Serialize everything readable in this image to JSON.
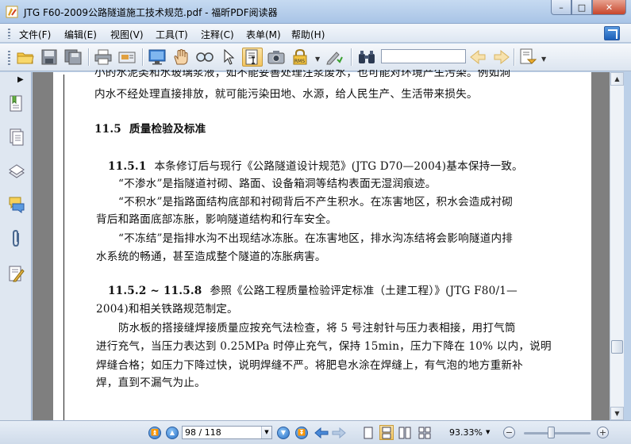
{
  "window": {
    "title": "JTG F60-2009公路隧道施工技术规范.pdf - 福昕PDF阅读器",
    "minimize": "–",
    "maximize": "□",
    "close": "✕"
  },
  "menu": [
    {
      "label": "文件(F)"
    },
    {
      "label": "编辑(E)"
    },
    {
      "label": "视图(V)"
    },
    {
      "label": "工具(T)"
    },
    {
      "label": "注释(C)"
    },
    {
      "label": "表单(M)"
    },
    {
      "label": "帮助(H)"
    }
  ],
  "toolbar": {
    "search_value": "",
    "icons": [
      "open-folder-icon",
      "save-icon",
      "save-as-icon",
      "print-icon",
      "scan-icon",
      "fullscreen-icon",
      "hand-icon",
      "zoom-glass-icon",
      "select-arrow-icon",
      "text-select-icon",
      "snapshot-icon",
      "rms-icon",
      "sign-icon",
      "binoculars-icon",
      "search-prev-icon",
      "search-next-icon",
      "highlight-icon"
    ]
  },
  "sidebar": {
    "icons": [
      "bookmarks-icon",
      "pages-icon",
      "layers-icon",
      "comments-icon",
      "attachments-icon",
      "signatures-icon"
    ]
  },
  "document": {
    "lines": [
      {
        "text": "小的水泥类和水玻璃浆液，如不能妥善处理注浆废水，也可能对环境产生污染。例如洞"
      },
      {
        "text": "内水不经处理直接排放，就可能污染田地、水源，给人民生产、生活带来损失。"
      },
      {
        "num": "11.5",
        "text": "质量检验及标准"
      },
      {
        "num": "11.5.1",
        "text": "本条修订后与现行《公路隧道设计规范》(JTG D70—2004)基本保持一致。"
      },
      {
        "text": "“不渗水”是指隧道衬砌、路面、设备箱洞等结构表面无湿润痕迹。"
      },
      {
        "text": "“不积水”是指路面结构底部和衬砌背后不产生积水。在冻害地区，积水会造成衬砌"
      },
      {
        "text": "背后和路面底部冻胀，影响隧道结构和行车安全。"
      },
      {
        "text": "“不冻结”是指排水沟不出现结冰冻胀。在冻害地区，排水沟冻结将会影响隧道内排"
      },
      {
        "text": "水系统的畅通，甚至造成整个隧道的冻胀病害。"
      },
      {
        "num": "11.5.2 ~ 11.5.8",
        "text": "参照《公路工程质量检验评定标准（土建工程）》(JTG F80/1—"
      },
      {
        "text": "2004)和相关铁路规范制定。"
      },
      {
        "text": "防水板的搭接缝焊接质量应按充气法检查，将 5 号注射针与压力表相接，用打气筒"
      },
      {
        "text": "进行充气，当压力表达到 0.25MPa 时停止充气，保持 15min，压力下降在 10% 以内，说明"
      },
      {
        "text": "焊缝合格；如压力下降过快，说明焊缝不严。将肥皂水涂在焊缝上，有气泡的地方重新补"
      },
      {
        "text": "焊，直到不漏气为止。"
      }
    ]
  },
  "statusbar": {
    "page_value": "98 / 118",
    "zoom": "93.33%",
    "zoom_out": "−",
    "zoom_in": "+"
  }
}
